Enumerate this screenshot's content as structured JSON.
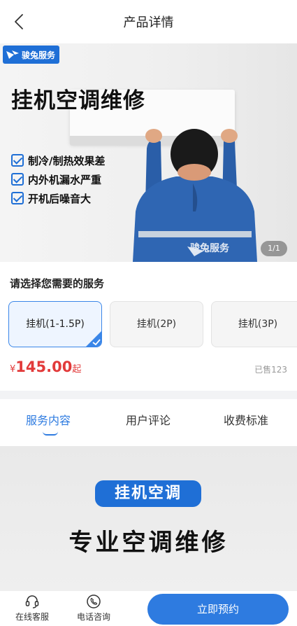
{
  "header": {
    "title": "产品详情",
    "back_icon": "chevron-left-icon"
  },
  "banner": {
    "logo_text": "骏兔服务",
    "title": "挂机空调维修",
    "features": [
      "制冷/制热效果差",
      "内外机漏水严重",
      "开机后噪音大"
    ],
    "uniform_text": "骏兔服务",
    "page_indicator": "1/1"
  },
  "service": {
    "heading": "请选择您需要的服务",
    "options": [
      {
        "label": "挂机(1-1.5P)",
        "selected": true
      },
      {
        "label": "挂机(2P)",
        "selected": false
      },
      {
        "label": "挂机(3P)",
        "selected": false
      }
    ],
    "price": {
      "currency": "¥",
      "amount": "145.00",
      "suffix": "起"
    },
    "sold": "已售123"
  },
  "tabs": [
    {
      "label": "服务内容",
      "active": true
    },
    {
      "label": "用户评论",
      "active": false
    },
    {
      "label": "收费标准",
      "active": false
    }
  ],
  "detail": {
    "pill": "挂机空调",
    "title": "专业空调维修"
  },
  "bottom_bar": {
    "service_label": "在线客服",
    "phone_label": "电话咨询",
    "book_label": "立即预约"
  },
  "colors": {
    "accent": "#2e7be0",
    "brand": "#1f6fd6",
    "price": "#e23a3a"
  }
}
